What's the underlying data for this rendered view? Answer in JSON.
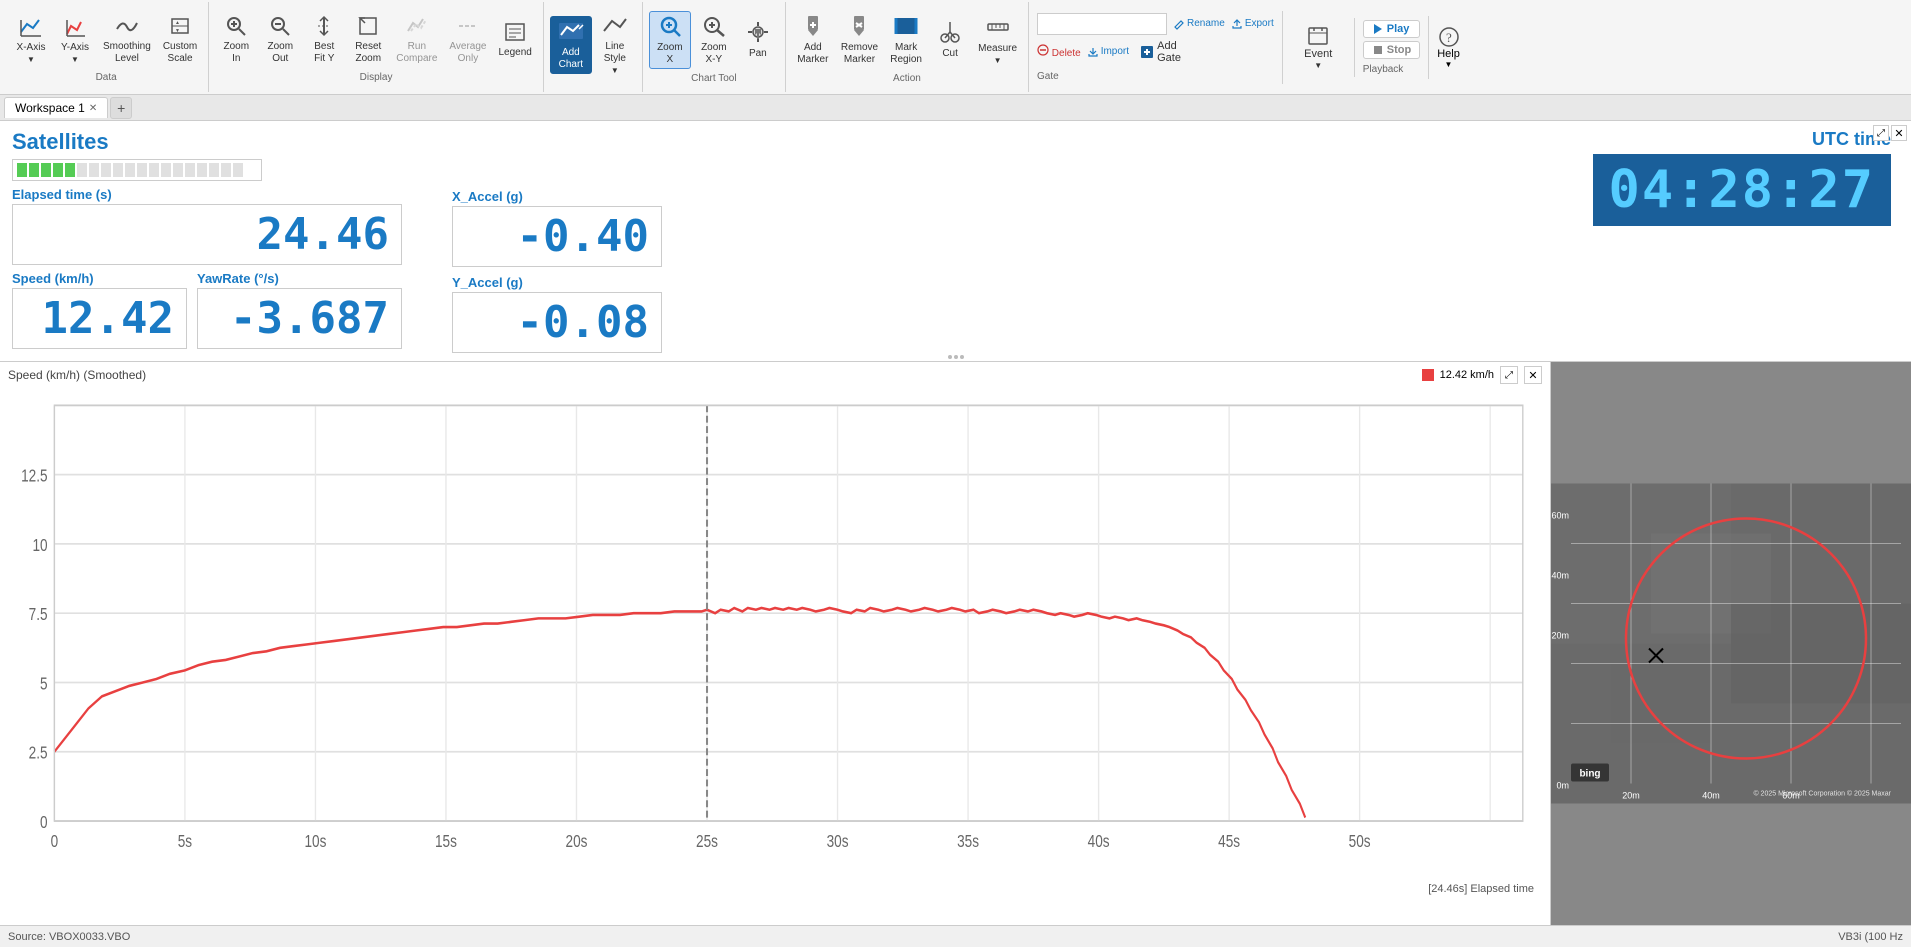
{
  "toolbar": {
    "groups": {
      "data": {
        "label": "Data",
        "items": [
          {
            "id": "x-axis",
            "icon": "📈",
            "label": "X-Axis",
            "dropdown": true
          },
          {
            "id": "y-axis",
            "icon": "📉",
            "label": "Y-Axis",
            "dropdown": true
          },
          {
            "id": "smoothing",
            "icon": "〰",
            "label": "Smoothing\nLevel"
          },
          {
            "id": "custom",
            "icon": "🔧",
            "label": "Custom\nScale"
          }
        ]
      },
      "display": {
        "label": "Display",
        "items": [
          {
            "id": "zoom-in",
            "icon": "🔍",
            "label": "Zoom\nIn"
          },
          {
            "id": "zoom-out",
            "icon": "🔎",
            "label": "Zoom\nOut"
          },
          {
            "id": "best-fit-y",
            "icon": "↕",
            "label": "Best\nFit Y"
          },
          {
            "id": "reset-zoom",
            "icon": "⊡",
            "label": "Reset\nZoom"
          },
          {
            "id": "run-compare",
            "icon": "▶",
            "label": "Run\nCompare"
          },
          {
            "id": "average-only",
            "icon": "≈",
            "label": "Average\nOnly"
          },
          {
            "id": "legend",
            "icon": "☰",
            "label": "Legend"
          }
        ]
      },
      "chart": {
        "label": "",
        "items": [
          {
            "id": "add-chart",
            "icon": "📊",
            "label": "Add\nChart",
            "active": true
          },
          {
            "id": "line-style",
            "icon": "—",
            "label": "Line\nStyle",
            "dropdown": true
          }
        ]
      },
      "chart-tool": {
        "label": "Chart Tool",
        "items": [
          {
            "id": "zoom-x",
            "icon": "⊕",
            "label": "Zoom\nX",
            "active": true
          },
          {
            "id": "zoom-xy",
            "icon": "⊞",
            "label": "Zoom\nX-Y"
          },
          {
            "id": "pan",
            "icon": "✋",
            "label": "Pan"
          }
        ]
      },
      "action": {
        "label": "Action",
        "items": [
          {
            "id": "add-marker",
            "icon": "🏷",
            "label": "Add\nMarker"
          },
          {
            "id": "remove-marker",
            "icon": "🗑",
            "label": "Remove\nMarker"
          },
          {
            "id": "mark-region",
            "icon": "▦",
            "label": "Mark\nRegion"
          },
          {
            "id": "cut",
            "icon": "✂",
            "label": "Cut"
          },
          {
            "id": "measure",
            "icon": "📏",
            "label": "Measure",
            "dropdown": true
          }
        ]
      }
    },
    "gate": {
      "label": "Gate",
      "rename_label": "Rename",
      "export_label": "Export",
      "delete_label": "Delete",
      "import_label": "Import",
      "add_gate_label": "Add\nGate",
      "input_placeholder": ""
    },
    "event": {
      "label": "Event",
      "dropdown": true
    },
    "playback": {
      "label": "Playback",
      "play_label": "Play",
      "stop_label": "Stop"
    },
    "help": {
      "label": "Help",
      "dropdown": true
    }
  },
  "tabs": [
    {
      "label": "Workspace 1",
      "closeable": true,
      "active": true
    }
  ],
  "tab_add_label": "+",
  "metrics": {
    "satellites_label": "Satellites",
    "satellites_count": 5,
    "satellites_total": 19,
    "elapsed_label": "Elapsed time (s)",
    "elapsed_value": "24.46",
    "speed_label": "Speed (km/h)",
    "speed_value": "12.42",
    "yawrate_label": "YawRate (°/s)",
    "yawrate_value": "-3.687",
    "xaccel_label": "X_Accel (g)",
    "xaccel_value": "-0.40",
    "yaccel_label": "Y_Accel (g)",
    "yaccel_value": "-0.08"
  },
  "utc": {
    "label": "UTC time",
    "value": "04:28:27"
  },
  "chart": {
    "title": "Speed (km/h) (Smoothed)",
    "legend_label": "12.42 km/h",
    "timestamp_label": "[24.46s] Elapsed time",
    "x_labels": [
      "0",
      "5s",
      "10s",
      "15s",
      "20s",
      "25s",
      "30s",
      "35s",
      "40s",
      "45s",
      "50s"
    ],
    "y_labels": [
      "0",
      "2.5",
      "5",
      "7.5",
      "10",
      "12.5"
    ]
  },
  "map": {
    "x_labels": [
      "20m",
      "40m",
      "60m"
    ],
    "y_labels": [
      "0m",
      "20m",
      "40m",
      "60m"
    ],
    "bing_label": "bing",
    "copyright": "© 2025 Microsoft Corporation  © 2025 Maxar"
  },
  "status_bar": {
    "source": "Source: VBOX0033.VBO",
    "device": "VB3i (100 Hz"
  }
}
